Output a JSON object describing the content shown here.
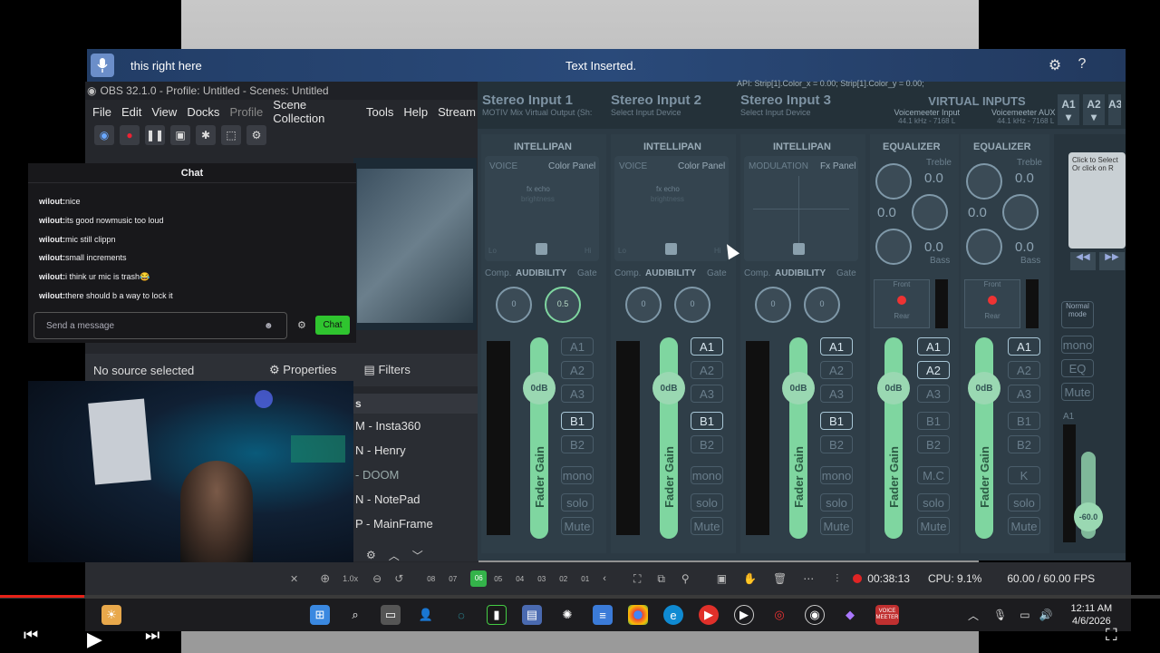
{
  "dictation": {
    "text": "this right here",
    "status": "Text Inserted.",
    "settings_icon": "gear-icon",
    "help_icon": "?"
  },
  "obs": {
    "title": "OBS 32.1.0 - Profile: Untitled - Scenes: Untitled",
    "menu": [
      "File",
      "Edit",
      "View",
      "Docks",
      "Profile",
      "Scene Collection",
      "Tools",
      "Help",
      "Stream"
    ],
    "no_source": "No source selected",
    "properties": "Properties",
    "filters": "Filters",
    "scenes_header": "s",
    "scenes": [
      "M - Insta360",
      "N - Henry",
      "- DOOM",
      "N - NotePad",
      "P - MainFrame"
    ],
    "timer": "00:38:13",
    "cpu": "CPU: 9.1%",
    "fps": "60.00 / 60.00 FPS",
    "timeline": [
      "08",
      "07",
      "06",
      "05",
      "04",
      "03",
      "02",
      "01"
    ],
    "timeline_active": "06",
    "zoom": "1.0x"
  },
  "chat": {
    "title": "Chat",
    "messages": [
      {
        "user": "wilout:",
        "text": " nice"
      },
      {
        "user": "wilout:",
        "text": " its good nowmusic too loud"
      },
      {
        "user": "wilout:",
        "text": " mic still clippn"
      },
      {
        "user": "wilout:",
        "text": " small increments"
      },
      {
        "user": "wilout:",
        "text": " i think ur mic is trash😂"
      },
      {
        "user": "wilout:",
        "text": " there should b a way to lock it"
      }
    ],
    "placeholder": "Send a message",
    "button": "Chat"
  },
  "voicemeeter": {
    "api_text": "API: Strip[1].Color_x = 0.00; Strip[1].Color_y = 0.00;",
    "strips": [
      {
        "title": "Stereo Input 1",
        "sub": "MOTIV Mix Virtual Output (Sh:",
        "mode": "VOICE",
        "panel": "Color Panel",
        "fx": "fx echo",
        "bright": "brightness",
        "k1": "0",
        "k2": "0.5",
        "buses": [
          "A1",
          "A2",
          "A3",
          "B1",
          "B2"
        ],
        "on": [
          false,
          false,
          false,
          true,
          false
        ]
      },
      {
        "title": "Stereo Input 2",
        "sub": "Select Input Device",
        "mode": "VOICE",
        "panel": "Color Panel",
        "fx": "fx echo",
        "bright": "brightness",
        "k1": "0",
        "k2": "0",
        "buses": [
          "A1",
          "A2",
          "A3",
          "B1",
          "B2"
        ],
        "on": [
          true,
          false,
          false,
          true,
          false
        ]
      },
      {
        "title": "Stereo Input 3",
        "sub": "Select Input Device",
        "mode": "MODULATION",
        "panel": "Fx Panel",
        "fx": "",
        "bright": "",
        "k1": "0",
        "k2": "0",
        "buses": [
          "A1",
          "A2",
          "A3",
          "B1",
          "B2"
        ],
        "on": [
          true,
          false,
          false,
          true,
          false
        ]
      }
    ],
    "virtual_title": "VIRTUAL INPUTS",
    "virtual": [
      {
        "name": "Voicemeeter Input",
        "rate": "44.1 kHz - 7168 L",
        "on": [
          true,
          true,
          false,
          false,
          false
        ],
        "mid": "M.C"
      },
      {
        "name": "Voicemeeter AUX I",
        "rate": "44.1 kHz - 7168 L",
        "on": [
          true,
          false,
          false,
          false,
          false
        ],
        "mid": "K"
      }
    ],
    "intellipan": "INTELLIPAN",
    "equalizer": "EQUALIZER",
    "treble": "Treble",
    "bass": "Bass",
    "eq_val": "0.0",
    "comp": "Comp.",
    "audibility": "AUDIBILITY",
    "gate": "Gate",
    "fader_db": "0dB",
    "fader_gain": "Fader Gain",
    "mono": "mono",
    "solo": "solo",
    "mute": "Mute",
    "front": "Front",
    "rear": "Rear",
    "lo": "Lo",
    "hi": "Hi",
    "hw_out": [
      "A1",
      "A2",
      "A3"
    ],
    "click_select": "Click to Select",
    "or_click": "Or click on R",
    "normal_mode": "Normal mode",
    "eq": "EQ",
    "master_db": "-60.0"
  },
  "taskbar": {
    "time": "12:11 AM",
    "date": "4/6/2026",
    "icons": [
      "windows-start-icon",
      "search-icon",
      "task-view-icon",
      "people-icon",
      "copilot-icon",
      "audio-bars-icon",
      "app-icon",
      "chatgpt-icon",
      "notepad-icon",
      "chrome-icon",
      "edge-icon",
      "youtube-icon",
      "player-icon",
      "recorder-icon",
      "obs-icon",
      "gem-icon",
      "voicemeeter-icon"
    ],
    "voicemeeter_label": "VOICE MEETER"
  }
}
